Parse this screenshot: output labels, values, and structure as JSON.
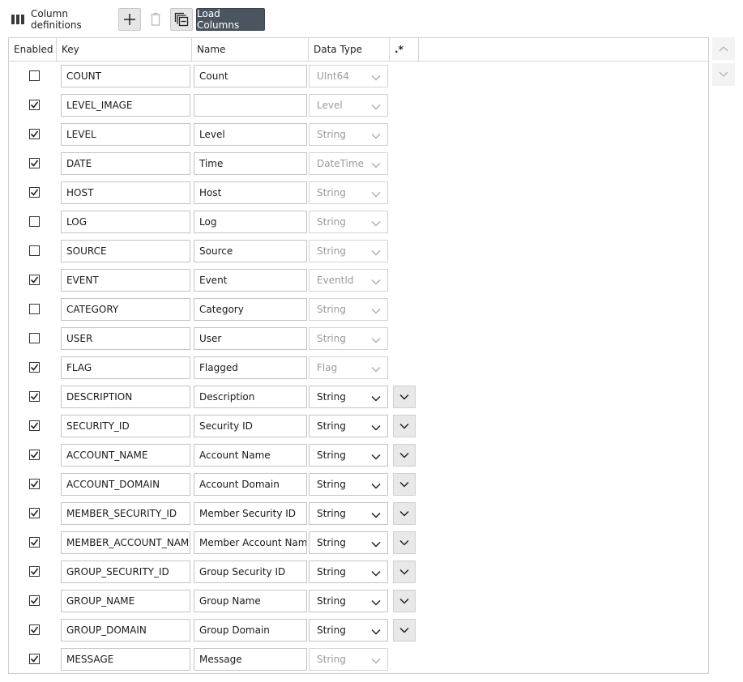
{
  "toolbar": {
    "title": "Column definitions",
    "load_label": "Load Columns"
  },
  "headers": {
    "enabled": "Enabled",
    "key": "Key",
    "name": "Name",
    "data_type": "Data Type",
    "regex": ".*"
  },
  "rows": [
    {
      "enabled": false,
      "key": "COUNT",
      "name": "Count",
      "type": "UInt64",
      "type_enabled": false,
      "expand": false
    },
    {
      "enabled": true,
      "key": "LEVEL_IMAGE",
      "name": "",
      "type": "Level",
      "type_enabled": false,
      "expand": false
    },
    {
      "enabled": true,
      "key": "LEVEL",
      "name": "Level",
      "type": "String",
      "type_enabled": false,
      "expand": false
    },
    {
      "enabled": true,
      "key": "DATE",
      "name": "Time",
      "type": "DateTime",
      "type_enabled": false,
      "expand": false
    },
    {
      "enabled": true,
      "key": "HOST",
      "name": "Host",
      "type": "String",
      "type_enabled": false,
      "expand": false
    },
    {
      "enabled": false,
      "key": "LOG",
      "name": "Log",
      "type": "String",
      "type_enabled": false,
      "expand": false
    },
    {
      "enabled": false,
      "key": "SOURCE",
      "name": "Source",
      "type": "String",
      "type_enabled": false,
      "expand": false
    },
    {
      "enabled": true,
      "key": "EVENT",
      "name": "Event",
      "type": "EventId",
      "type_enabled": false,
      "expand": false
    },
    {
      "enabled": false,
      "key": "CATEGORY",
      "name": "Category",
      "type": "String",
      "type_enabled": false,
      "expand": false
    },
    {
      "enabled": false,
      "key": "USER",
      "name": "User",
      "type": "String",
      "type_enabled": false,
      "expand": false
    },
    {
      "enabled": true,
      "key": "FLAG",
      "name": "Flagged",
      "type": "Flag",
      "type_enabled": false,
      "expand": false
    },
    {
      "enabled": true,
      "key": "DESCRIPTION",
      "name": "Description",
      "type": "String",
      "type_enabled": true,
      "expand": true
    },
    {
      "enabled": true,
      "key": "SECURITY_ID",
      "name": "Security ID",
      "type": "String",
      "type_enabled": true,
      "expand": true
    },
    {
      "enabled": true,
      "key": "ACCOUNT_NAME",
      "name": "Account Name",
      "type": "String",
      "type_enabled": true,
      "expand": true
    },
    {
      "enabled": true,
      "key": "ACCOUNT_DOMAIN",
      "name": "Account Domain",
      "type": "String",
      "type_enabled": true,
      "expand": true
    },
    {
      "enabled": true,
      "key": "MEMBER_SECURITY_ID",
      "name": "Member Security ID",
      "type": "String",
      "type_enabled": true,
      "expand": true
    },
    {
      "enabled": true,
      "key": "MEMBER_ACCOUNT_NAME",
      "name": "Member Account Name",
      "type": "String",
      "type_enabled": true,
      "expand": true
    },
    {
      "enabled": true,
      "key": "GROUP_SECURITY_ID",
      "name": "Group Security ID",
      "type": "String",
      "type_enabled": true,
      "expand": true
    },
    {
      "enabled": true,
      "key": "GROUP_NAME",
      "name": "Group Name",
      "type": "String",
      "type_enabled": true,
      "expand": true
    },
    {
      "enabled": true,
      "key": "GROUP_DOMAIN",
      "name": "Group Domain",
      "type": "String",
      "type_enabled": true,
      "expand": true
    },
    {
      "enabled": true,
      "key": "MESSAGE",
      "name": "Message",
      "type": "String",
      "type_enabled": false,
      "expand": false
    }
  ]
}
